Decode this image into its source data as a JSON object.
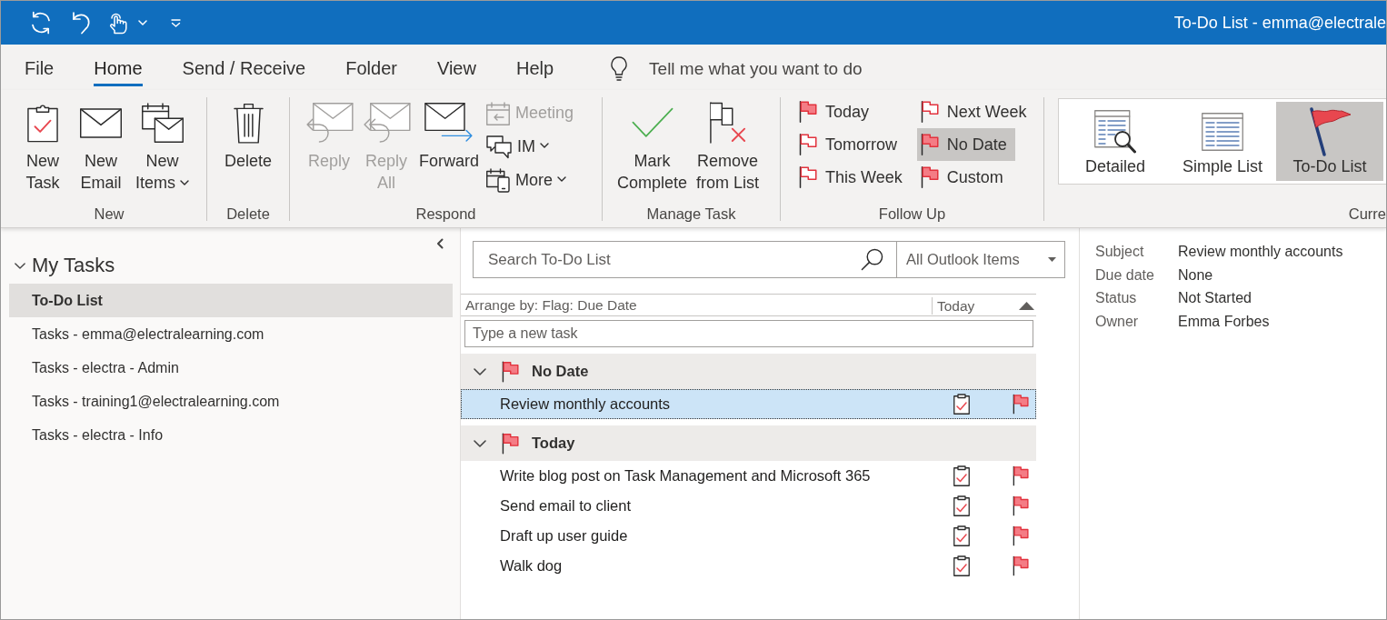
{
  "window": {
    "title": "To-Do List - emma@electrale"
  },
  "ribbon": {
    "tabs": [
      {
        "label": "File",
        "selected": false
      },
      {
        "label": "Home",
        "selected": true
      },
      {
        "label": "Send / Receive",
        "selected": false
      },
      {
        "label": "Folder",
        "selected": false
      },
      {
        "label": "View",
        "selected": false
      },
      {
        "label": "Help",
        "selected": false
      }
    ],
    "tell_me": {
      "placeholder": "Tell me what you want to do"
    },
    "groups": [
      {
        "label": "New",
        "kind": "buttons",
        "buttons": [
          {
            "kind": "large",
            "label": "New\nTask",
            "disabled": false,
            "dropdown": false
          },
          {
            "kind": "large",
            "label": "New\nEmail",
            "disabled": false,
            "dropdown": false
          },
          {
            "kind": "large",
            "label": "New\nItems",
            "disabled": false,
            "dropdown": true
          }
        ]
      },
      {
        "label": "Delete",
        "kind": "buttons",
        "buttons": [
          {
            "kind": "large",
            "label": "Delete",
            "disabled": false,
            "dropdown": false
          }
        ]
      },
      {
        "label": "Respond",
        "kind": "buttons",
        "buttons": [
          {
            "kind": "large",
            "label": "Reply",
            "disabled": true,
            "dropdown": false
          },
          {
            "kind": "large",
            "label": "Reply\nAll",
            "disabled": true,
            "dropdown": false
          },
          {
            "kind": "large",
            "label": "Forward",
            "disabled": false,
            "dropdown": false
          },
          {
            "kind": "small",
            "label": "Meeting",
            "disabled": true,
            "dropdown": false
          },
          {
            "kind": "small",
            "label": "IM",
            "disabled": false,
            "dropdown": true
          },
          {
            "kind": "small",
            "label": "More",
            "disabled": false,
            "dropdown": true
          }
        ]
      },
      {
        "label": "Manage Task",
        "kind": "buttons",
        "buttons": [
          {
            "kind": "large",
            "label": "Mark\nComplete",
            "disabled": false,
            "dropdown": false
          },
          {
            "kind": "large",
            "label": "Remove\nfrom List",
            "disabled": false,
            "dropdown": false
          }
        ]
      },
      {
        "label": "Follow Up",
        "kind": "flags",
        "buttons": [
          {
            "label": "Today",
            "selected": false
          },
          {
            "label": "Tomorrow",
            "selected": false
          },
          {
            "label": "This Week",
            "selected": false
          },
          {
            "label": "Next Week",
            "selected": false
          },
          {
            "label": "No Date",
            "selected": true
          },
          {
            "label": "Custom",
            "selected": false
          }
        ]
      },
      {
        "label": "Curre",
        "kind": "gallery",
        "buttons": [
          {
            "label": "Detailed",
            "selected": false
          },
          {
            "label": "Simple List",
            "selected": false
          },
          {
            "label": "To-Do List",
            "selected": true
          }
        ]
      }
    ]
  },
  "navigation": {
    "header": "My Tasks",
    "expanded": true,
    "items": [
      {
        "label": "To-Do List",
        "selected": true
      },
      {
        "label": "Tasks - emma@electralearning.com",
        "selected": false
      },
      {
        "label": "Tasks - electra - Admin",
        "selected": false
      },
      {
        "label": "Tasks - training1@electralearning.com",
        "selected": false
      },
      {
        "label": "Tasks - electra - Info",
        "selected": false
      }
    ]
  },
  "task_list": {
    "search": {
      "placeholder": "Search To-Do List"
    },
    "scope": {
      "value": "All Outlook Items"
    },
    "arrange_by": "Arrange by: Flag: Due Date",
    "sort_column": "Today",
    "new_task": {
      "placeholder": "Type a new task"
    },
    "groups": [
      {
        "label": "No Date",
        "expanded": true,
        "tasks": [
          {
            "subject": "Review monthly accounts",
            "selected": true
          }
        ]
      },
      {
        "label": "Today",
        "expanded": true,
        "tasks": [
          {
            "subject": "Write blog post on Task Management and Microsoft 365",
            "selected": false
          },
          {
            "subject": "Send email to client",
            "selected": false
          },
          {
            "subject": "Draft up user guide",
            "selected": false
          },
          {
            "subject": "Walk dog",
            "selected": false
          }
        ]
      }
    ]
  },
  "reading_pane": {
    "fields": [
      {
        "label": "Subject",
        "value": "Review monthly accounts"
      },
      {
        "label": "Due date",
        "value": "None"
      },
      {
        "label": "Status",
        "value": "Not Started"
      },
      {
        "label": "Owner",
        "value": "Emma Forbes"
      }
    ]
  }
}
